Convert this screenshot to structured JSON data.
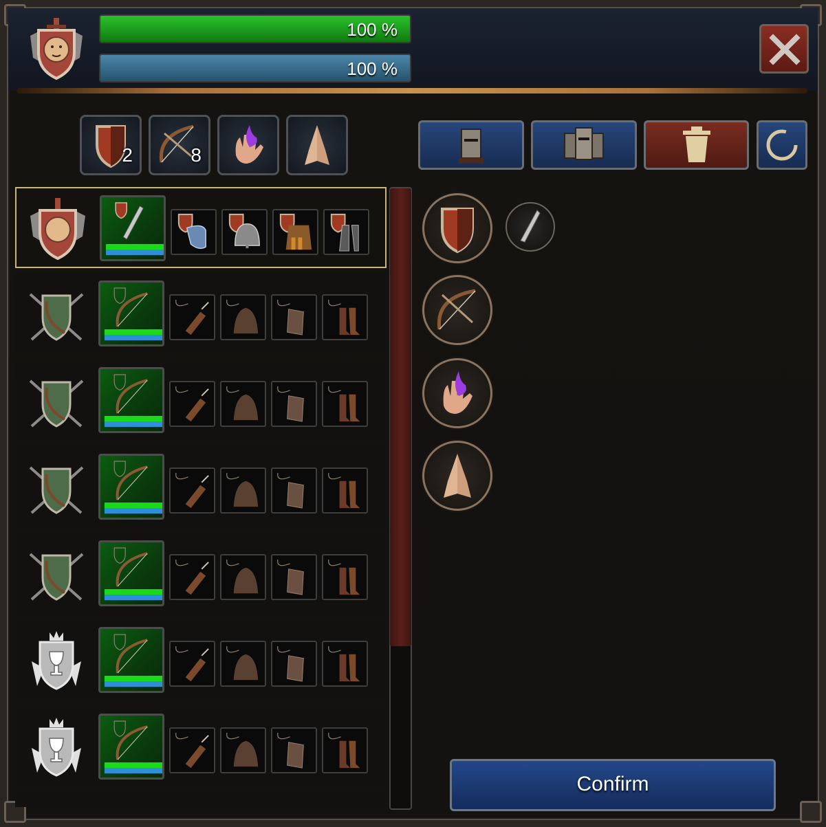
{
  "header": {
    "health_label": "100 %",
    "health_level": 1.0,
    "morale_label": "100 %",
    "morale_level": 1.0,
    "colors": {
      "health": "#1bb21b",
      "morale": "#3b7596",
      "close": "#7a2a20"
    }
  },
  "filters": [
    {
      "icon": "shield-icon",
      "count": "2"
    },
    {
      "icon": "bow-icon",
      "count": "8"
    },
    {
      "icon": "magic-hand-icon",
      "count": ""
    },
    {
      "icon": "praying-hands-icon",
      "count": ""
    }
  ],
  "tools": [
    {
      "icon": "knight-helmet-icon",
      "color": "blue"
    },
    {
      "icon": "knights-group-icon",
      "color": "blue"
    },
    {
      "icon": "trash-icon",
      "color": "red"
    },
    {
      "icon": "refresh-icon",
      "color": "blue"
    }
  ],
  "units": [
    {
      "crest": "lion-crest-icon",
      "weapon": "sword-icon",
      "selected": true,
      "health": 1.0,
      "morale": 1.0,
      "gear": [
        "shoulder-armor-icon",
        "helmet-icon",
        "chest-armor-icon",
        "greaves-icon"
      ]
    },
    {
      "crest": "archer-crest-icon",
      "weapon": "bow-icon",
      "selected": false,
      "health": 1.0,
      "morale": 1.0,
      "gear": [
        "quiver-icon",
        "hood-icon",
        "bracer-icon",
        "boots-icon"
      ]
    },
    {
      "crest": "archer-crest-icon",
      "weapon": "bow-icon",
      "selected": false,
      "health": 1.0,
      "morale": 1.0,
      "gear": [
        "quiver-icon",
        "hood-icon",
        "bracer-icon",
        "boots-icon"
      ]
    },
    {
      "crest": "archer-crest-icon",
      "weapon": "bow-icon",
      "selected": false,
      "health": 1.0,
      "morale": 1.0,
      "gear": [
        "quiver-icon",
        "hood-icon",
        "bracer-icon",
        "boots-icon"
      ]
    },
    {
      "crest": "archer-crest-icon",
      "weapon": "bow-icon",
      "selected": false,
      "health": 1.0,
      "morale": 1.0,
      "gear": [
        "quiver-icon",
        "hood-icon",
        "bracer-icon",
        "boots-icon"
      ]
    },
    {
      "crest": "chalice-crest-icon",
      "weapon": "bow-icon",
      "selected": false,
      "health": 1.0,
      "morale": 1.0,
      "gear": [
        "quiver-icon",
        "hood-icon",
        "bracer-icon",
        "boots-icon"
      ]
    },
    {
      "crest": "chalice-crest-icon",
      "weapon": "bow-icon",
      "selected": false,
      "health": 1.0,
      "morale": 1.0,
      "gear": [
        "quiver-icon",
        "hood-icon",
        "bracer-icon",
        "boots-icon"
      ]
    }
  ],
  "categories": [
    {
      "icon": "shield-icon",
      "items": [
        "sword-icon"
      ]
    },
    {
      "icon": "bow-icon",
      "items": []
    },
    {
      "icon": "magic-hand-icon",
      "items": []
    },
    {
      "icon": "praying-hands-icon",
      "items": []
    }
  ],
  "confirm_label": "Confirm"
}
